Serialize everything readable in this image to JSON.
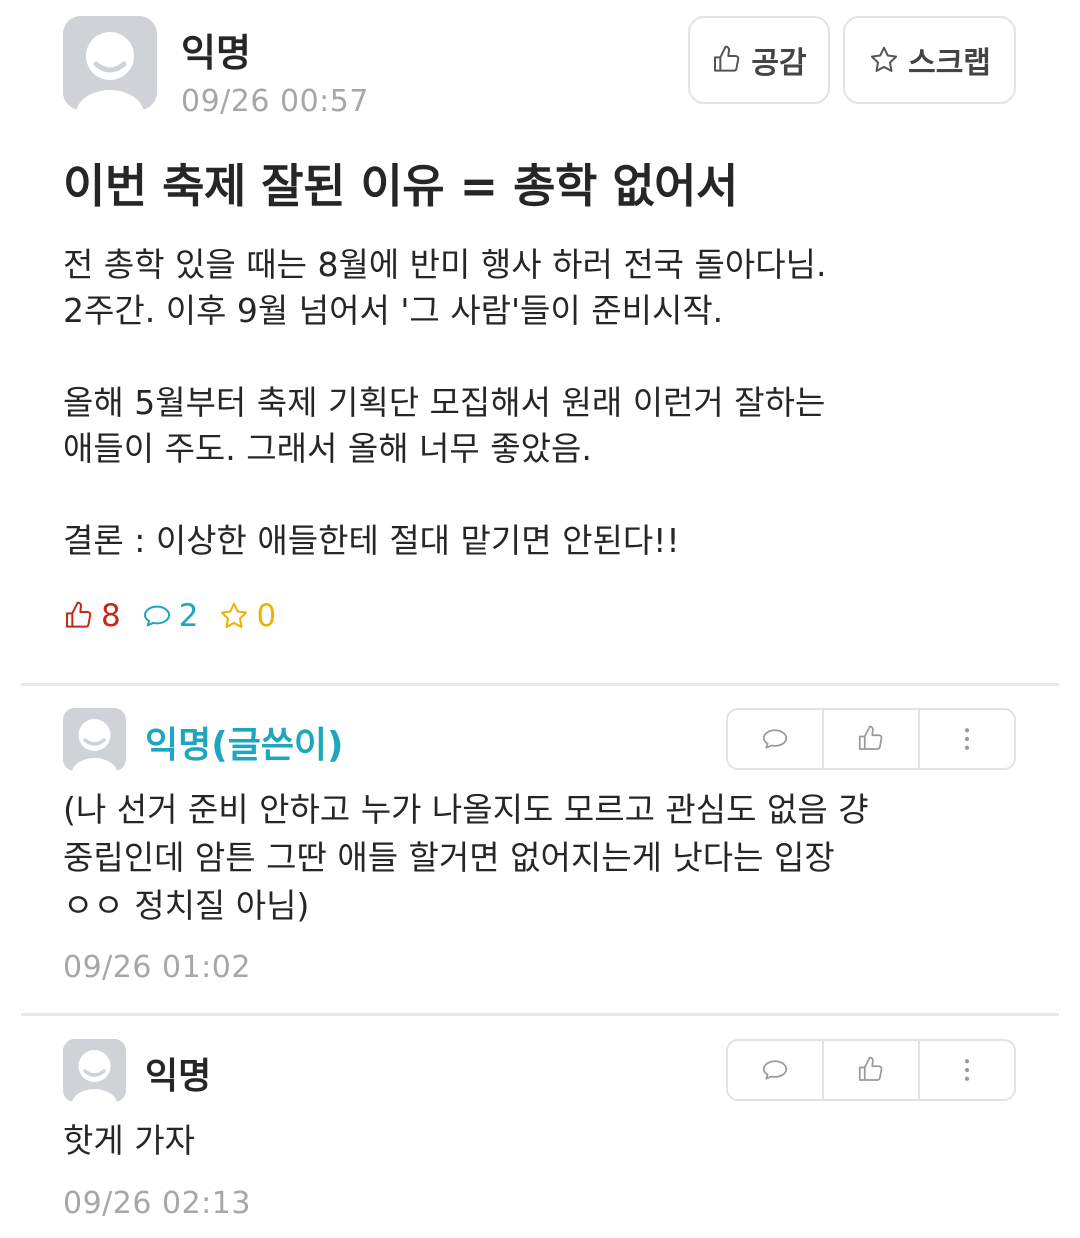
{
  "post": {
    "author": "익명",
    "time": "09/26 00:57",
    "like_button": "공감",
    "scrap_button": "스크랩",
    "title": "이번 축제 잘된 이유 = 총학 없어서",
    "body_lines": [
      "전 총학 있을 때는 8월에 반미 행사 하러 전국 돌아다님.",
      "2주간. 이후 9월 넘어서 '그 사람'들이 준비시작.",
      "",
      "올해 5월부터 축제 기획단 모집해서 원래 이런거 잘하는",
      "애들이 주도. 그래서 올해 너무 좋았음.",
      "",
      "결론 : 이상한 애들한테 절대 맡기면 안된다!!"
    ],
    "stats": {
      "likes": "8",
      "comments": "2",
      "scraps": "0"
    }
  },
  "comments": [
    {
      "author": "익명(글쓴이)",
      "text_lines": [
        "(나 선거 준비 안하고 누가 나올지도 모르고 관심도 없음 걍",
        "중립인데 암튼 그딴 애들 할거면 없어지는게 낫다는 입장",
        "ㅇㅇ 정치질 아님)"
      ],
      "time": "09/26 01:02"
    },
    {
      "author": "익명",
      "text_lines": [
        "핫게 가자"
      ],
      "time": "09/26 02:13"
    }
  ],
  "colors": {
    "like": "#c62917",
    "comment": "#1da6bd",
    "scrap": "#eab300",
    "author_op": "#1da6bd",
    "muted": "#a7a7a7"
  },
  "icons": {
    "like": "thumbs-up-icon",
    "comment": "speech-bubble-icon",
    "scrap": "star-icon",
    "more": "more-vertical-icon",
    "avatar": "default-avatar-icon"
  }
}
